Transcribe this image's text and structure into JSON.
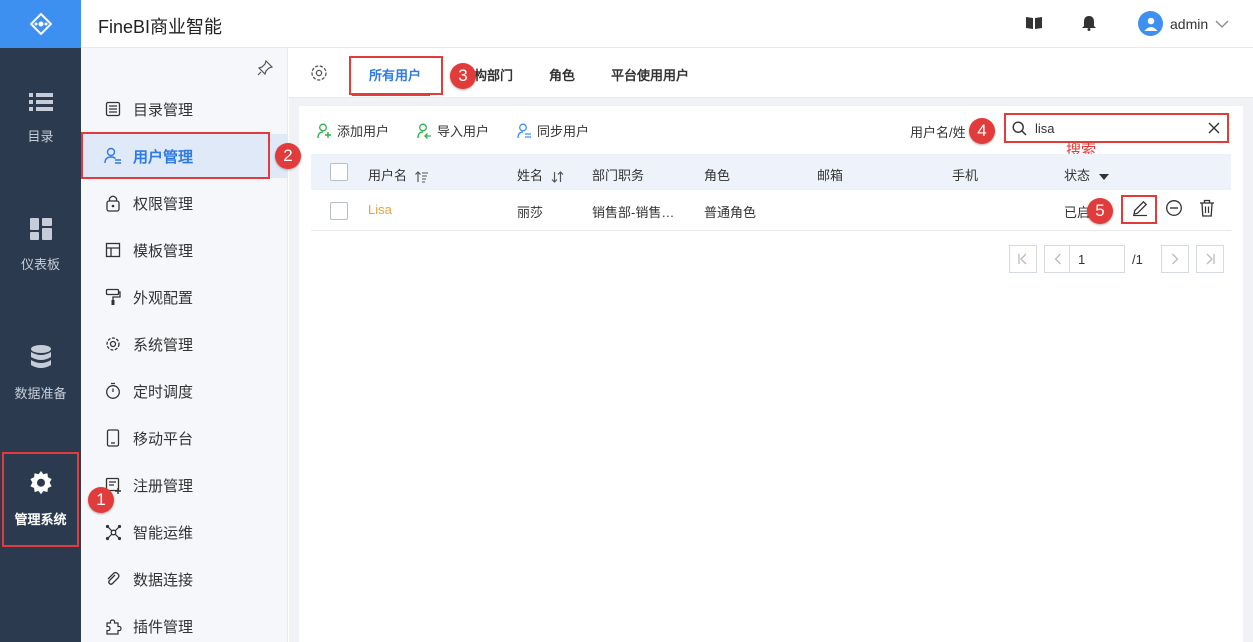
{
  "app": {
    "title": "FineBI商业智能"
  },
  "colors": {
    "accent": "#2f7be4",
    "rail_bg": "#2b3a4f",
    "annotation": "#e23b3b"
  },
  "rail": {
    "items": [
      {
        "label": "目录",
        "icon": "list-icon"
      },
      {
        "label": "仪表板",
        "icon": "dashboard-icon"
      },
      {
        "label": "数据准备",
        "icon": "database-icon"
      },
      {
        "label": "管理系统",
        "icon": "gear-icon",
        "active": true
      }
    ]
  },
  "header": {
    "user": "admin"
  },
  "sidebar": {
    "items": [
      {
        "label": "目录管理",
        "icon": "catalog-icon"
      },
      {
        "label": "用户管理",
        "icon": "user-icon",
        "active": true
      },
      {
        "label": "权限管理",
        "icon": "lock-icon"
      },
      {
        "label": "模板管理",
        "icon": "template-icon"
      },
      {
        "label": "外观配置",
        "icon": "brush-icon"
      },
      {
        "label": "系统管理",
        "icon": "gear-icon"
      },
      {
        "label": "定时调度",
        "icon": "timer-icon"
      },
      {
        "label": "移动平台",
        "icon": "mobile-icon"
      },
      {
        "label": "注册管理",
        "icon": "register-icon"
      },
      {
        "label": "智能运维",
        "icon": "ops-icon"
      },
      {
        "label": "数据连接",
        "icon": "link-icon"
      },
      {
        "label": "插件管理",
        "icon": "plugin-icon"
      }
    ]
  },
  "tabs": [
    {
      "label": "所有用户",
      "active": true
    },
    {
      "label": "构部门"
    },
    {
      "label": "角色"
    },
    {
      "label": "平台使用用户"
    }
  ],
  "actions": {
    "add": "添加用户",
    "import": "导入用户",
    "sync": "同步用户"
  },
  "search": {
    "label": "用户名/姓",
    "value": "lisa"
  },
  "annotation_text": "搜索",
  "table": {
    "columns": [
      "用户名",
      "姓名",
      "部门职务",
      "角色",
      "邮箱",
      "手机",
      "状态"
    ],
    "rows": [
      {
        "username": "Lisa",
        "name": "丽莎",
        "dept": "销售部-销售…",
        "role": "普通角色",
        "email": "",
        "phone": "",
        "status": "已启"
      }
    ]
  },
  "pagination": {
    "page": "1",
    "total": "/1"
  },
  "badges": [
    "1",
    "2",
    "3",
    "4",
    "5"
  ]
}
